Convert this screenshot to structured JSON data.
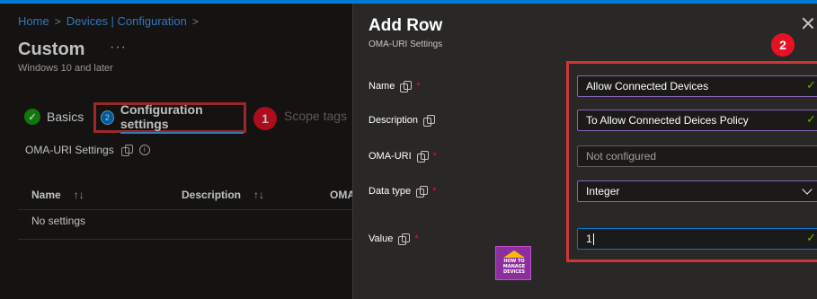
{
  "breadcrumb": {
    "home": "Home",
    "devices": "Devices | Configuration"
  },
  "page": {
    "title": "Custom",
    "more": "···",
    "subtitle": "Windows 10 and later"
  },
  "steps": {
    "basics": {
      "label": "Basics"
    },
    "configuration": {
      "number": "2",
      "label": "Configuration settings"
    },
    "scope": {
      "label": "Scope tags"
    }
  },
  "annotations": {
    "callout1": "1",
    "callout2": "2"
  },
  "oma_section": {
    "title": "OMA-URI Settings",
    "info": "i"
  },
  "table": {
    "columns": [
      "Name",
      "Description",
      "OMA"
    ],
    "sort_glyph": "↑↓",
    "empty_text": "No settings"
  },
  "add_row": {
    "title": "Add Row",
    "subtitle": "OMA-URI Settings",
    "fields": {
      "name": {
        "label": "Name",
        "required": "*",
        "value": "Allow Connected Devices"
      },
      "description": {
        "label": "Description",
        "value": "To Allow Connected Deices Policy"
      },
      "oma_uri": {
        "label": "OMA-URI",
        "required": "*",
        "placeholder": "Not configured"
      },
      "data_type": {
        "label": "Data type",
        "required": "*",
        "value": "Integer"
      },
      "value": {
        "label": "Value",
        "required": "*",
        "value": "1"
      }
    }
  },
  "logo": {
    "line1": "HOW TO",
    "line2": "MANAGE",
    "line3": "DEVICES"
  },
  "colors": {
    "accent": "#0078d4",
    "highlight": "#d13438",
    "callout": "#e81123",
    "field_border": "#8764b8",
    "valid_check": "#6bb700",
    "success": "#13a10e"
  },
  "icons": {
    "copy": "copy-icon",
    "info": "info-icon",
    "check": "checkmark-icon",
    "chevron": "chevron-down-icon",
    "close": "close-icon",
    "sort": "sort-icon"
  }
}
